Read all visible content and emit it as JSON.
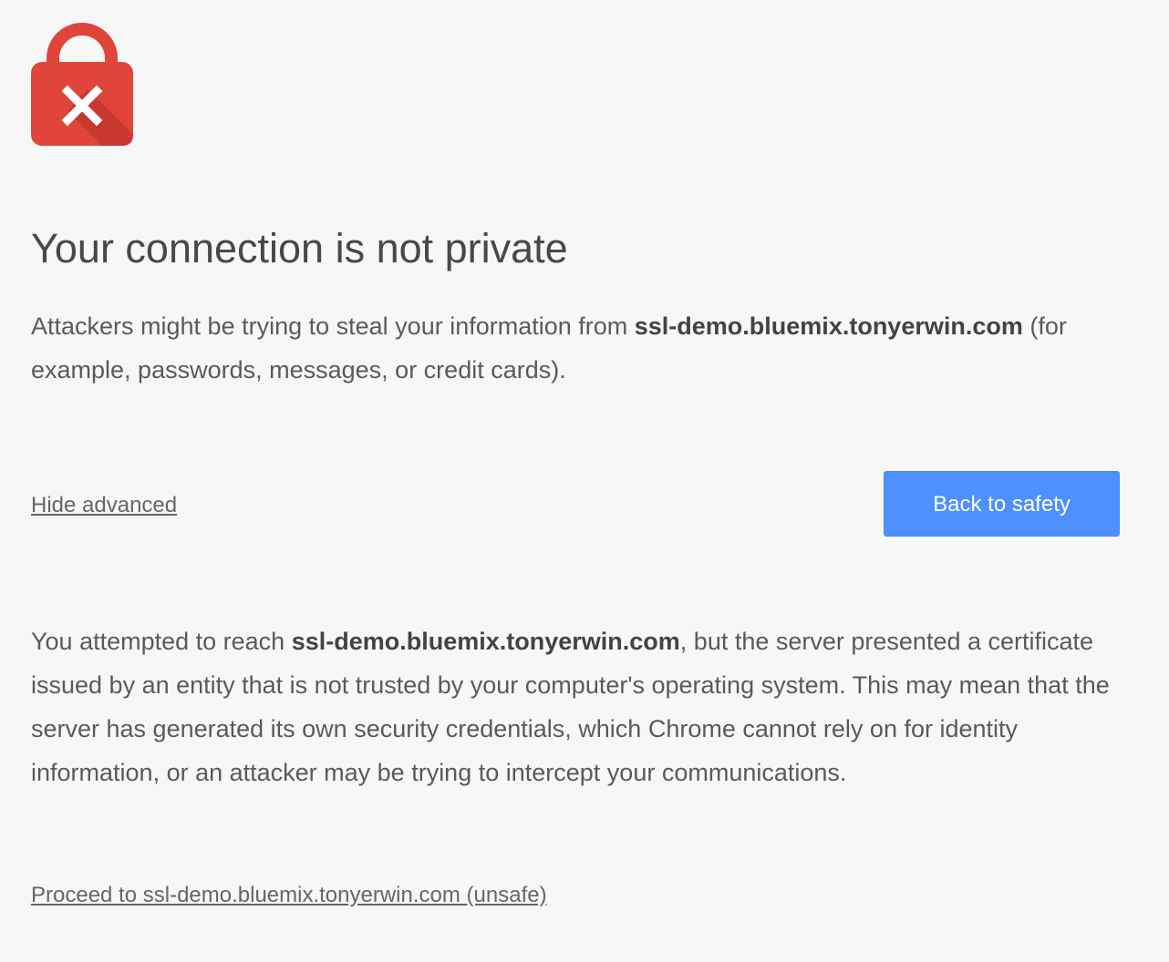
{
  "icon": {
    "name": "red-lock-error-icon",
    "colors": {
      "body": "#e0443a",
      "shackle": "#e0443a",
      "shadow": "#b3322b",
      "mark": "#ffffff"
    }
  },
  "heading": {
    "title": "Your connection is not private"
  },
  "summary": {
    "prefix": "Attackers might be trying to steal your information from ",
    "domain": "ssl-demo.bluemix.tonyerwin.com",
    "suffix": " (for example, passwords, messages, or credit cards)."
  },
  "actions": {
    "hide_advanced_label": "Hide advanced",
    "back_to_safety_label": "Back to safety"
  },
  "details": {
    "prefix": "You attempted to reach ",
    "domain": "ssl-demo.bluemix.tonyerwin.com",
    "suffix": ", but the server presented a certificate issued by an entity that is not trusted by your computer's operating system. This may mean that the server has generated its own security credentials, which Chrome cannot rely on for identity information, or an attacker may be trying to intercept your communications."
  },
  "proceed": {
    "label": "Proceed to ssl-demo.bluemix.tonyerwin.com (unsafe)"
  },
  "colors": {
    "background": "#f7f7f7",
    "button": "#4d90fe",
    "text": "#646464"
  }
}
